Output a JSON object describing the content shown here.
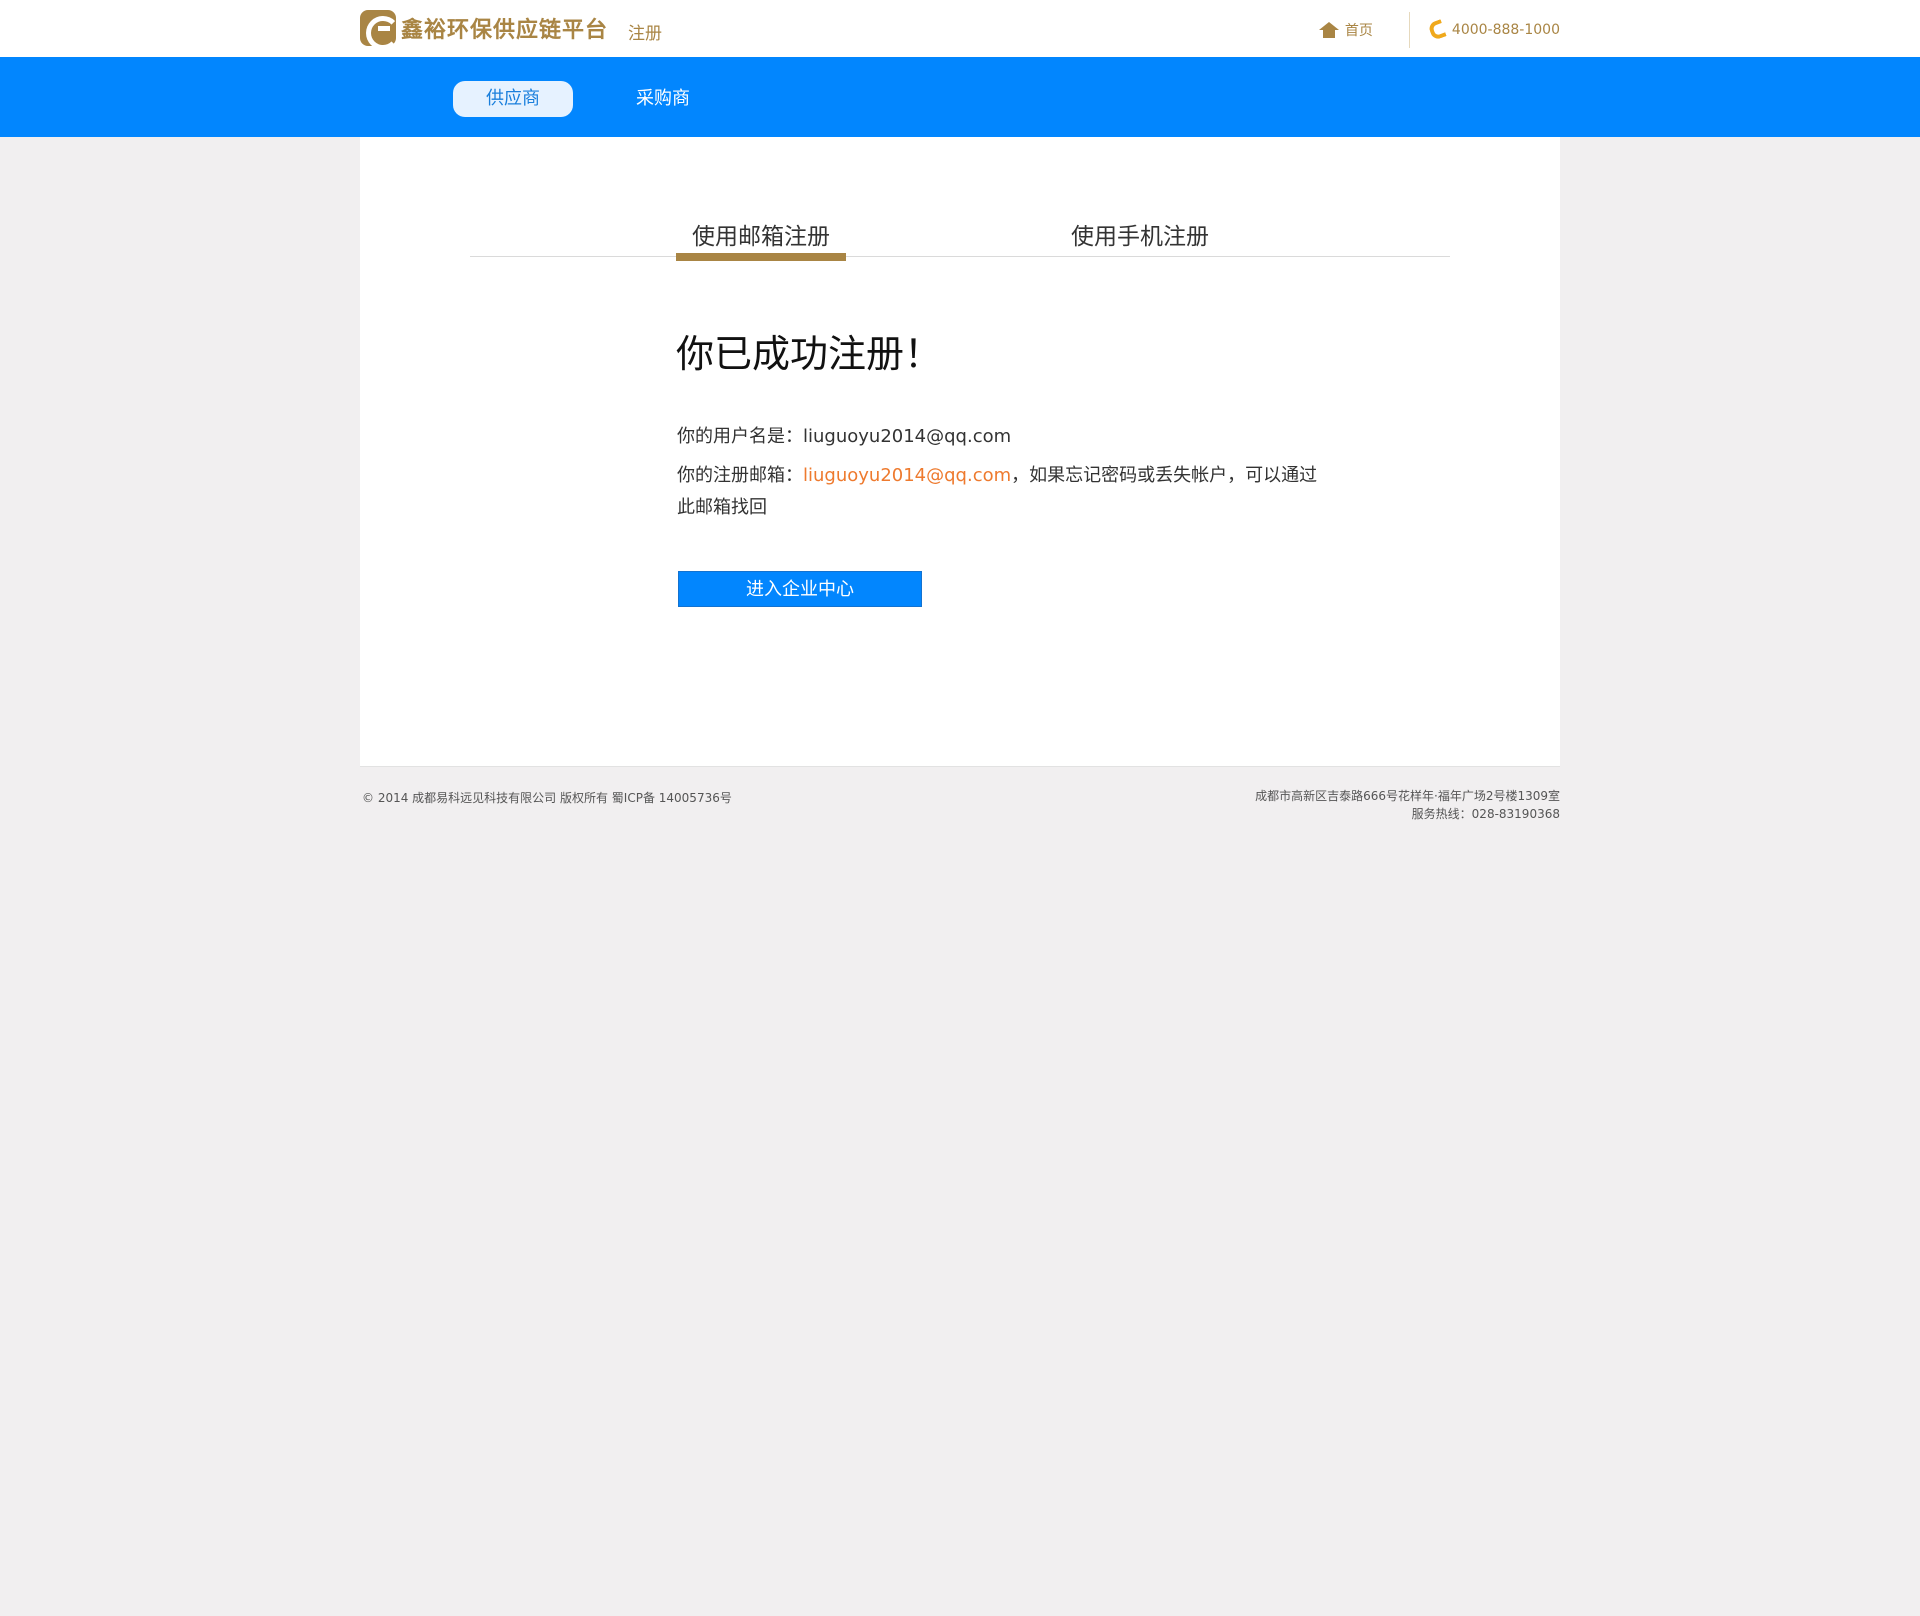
{
  "header": {
    "logo_title": "鑫裕环保供应链平台",
    "logo_subtitle": "注册",
    "home_label": "首页",
    "phone": "4000-888-1000"
  },
  "nav": {
    "tabs": [
      {
        "label": "供应商",
        "active": true
      },
      {
        "label": "采购商",
        "active": false
      }
    ]
  },
  "register_tabs": [
    {
      "label": "使用邮箱注册",
      "active": true
    },
    {
      "label": "使用手机注册",
      "active": false
    }
  ],
  "success": {
    "title": "你已成功注册！",
    "username_prefix": "你的用户名是：",
    "username": "liuguoyu2014@qq.com",
    "email_prefix": "你的注册邮箱：",
    "email": "liuguoyu2014@qq.com",
    "email_suffix": "，如果忘记密码或丢失帐户，可以通过此邮箱找回",
    "button_label": "进入企业中心"
  },
  "footer": {
    "copyright": "© 2014 成都易科远见科技有限公司 版权所有 蜀ICP备 14005736号",
    "address": "成都市高新区吉泰路666号花样年·福年广场2号楼1309室",
    "hotline": "服务热线：028-83190368"
  },
  "colors": {
    "brand_gold": "#a98544",
    "nav_blue": "#0286fe",
    "email_orange": "#ee7a2e",
    "phone_icon": "#f0a91c"
  }
}
